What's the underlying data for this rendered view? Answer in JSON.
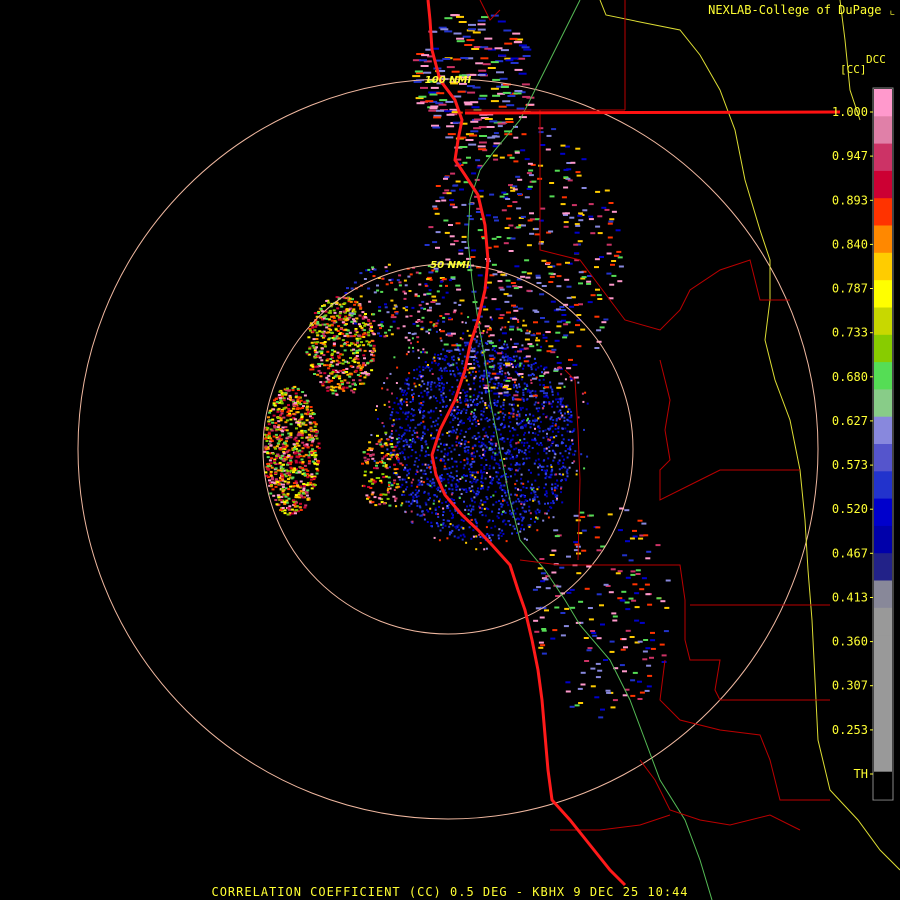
{
  "credit": "NEXLAB-College of DuPage",
  "colorbar": {
    "title_line1": "DCC",
    "title_line2": "[CC]",
    "ticks": [
      "1.000",
      "0.947",
      "0.893",
      "0.840",
      "0.787",
      "0.733",
      "0.680",
      "0.627",
      "0.573",
      "0.520",
      "0.467",
      "0.413",
      "0.360",
      "0.307",
      "0.253",
      "TH"
    ],
    "colors": [
      "#ff99cc",
      "#e080a8",
      "#cc3366",
      "#cc0033",
      "#ff3300",
      "#ff8800",
      "#ffcc00",
      "#ffff00",
      "#c8d800",
      "#88cc00",
      "#55dd55",
      "#88cc88",
      "#8888dd",
      "#5555cc",
      "#2233cc",
      "#0000cc",
      "#0000aa",
      "#222288",
      "#888899",
      "#999999",
      "#999999",
      "#999999",
      "#999999",
      "#999999",
      "#999999",
      "#000000"
    ]
  },
  "range_rings": [
    {
      "label": "50 NMI"
    },
    {
      "label": "100 NMI"
    }
  ],
  "footer": "CORRELATION COEFFICIENT (CC) 0.5 DEG - KBHX 9 DEC 25 10:44",
  "colors": {
    "background": "#000000",
    "ring": "#f0b8a0",
    "coastline": "#ff0000",
    "county": "#cc0000",
    "state": "#ffff33",
    "highway": "#66cc66",
    "text": "#ffff33"
  }
}
